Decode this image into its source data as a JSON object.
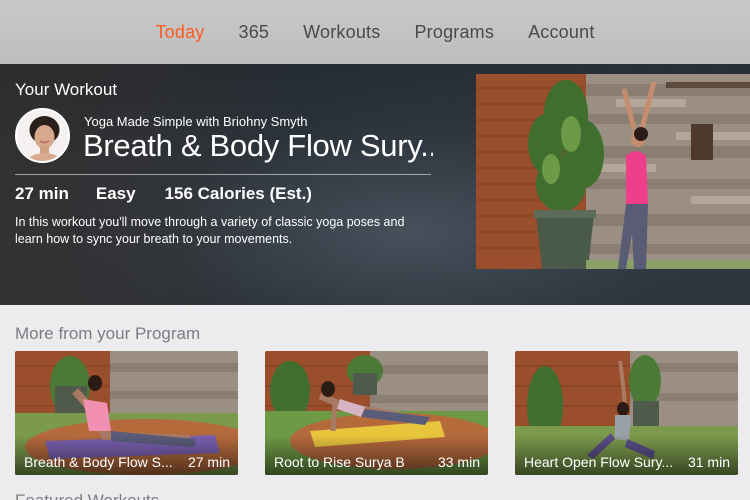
{
  "nav": {
    "items": [
      {
        "label": "Today",
        "active": true
      },
      {
        "label": "365",
        "active": false
      },
      {
        "label": "Workouts",
        "active": false
      },
      {
        "label": "Programs",
        "active": false
      },
      {
        "label": "Account",
        "active": false
      }
    ]
  },
  "hero": {
    "label": "Your Workout",
    "program": "Yoga Made Simple with Briohny Smyth",
    "title": "Breath & Body Flow Sury...",
    "stats": {
      "duration": "27 min",
      "difficulty": "Easy",
      "calories": "156 Calories (Est.)"
    },
    "description": "In this workout you'll move through a variety of classic yoga poses and learn how to sync your breath to your movements."
  },
  "section": {
    "title": "More from your Program",
    "cards": [
      {
        "title": "Breath & Body Flow S...",
        "duration": "27 min"
      },
      {
        "title": "Root to Rise Surya B",
        "duration": "33 min"
      },
      {
        "title": "Heart Open Flow Sury...",
        "duration": "31 min"
      }
    ]
  },
  "next_section": {
    "title": "Featured Workouts"
  },
  "colors": {
    "accent": "#ff5a1f",
    "nav_bg": "#c4c4c4",
    "page_bg": "#ececef"
  }
}
